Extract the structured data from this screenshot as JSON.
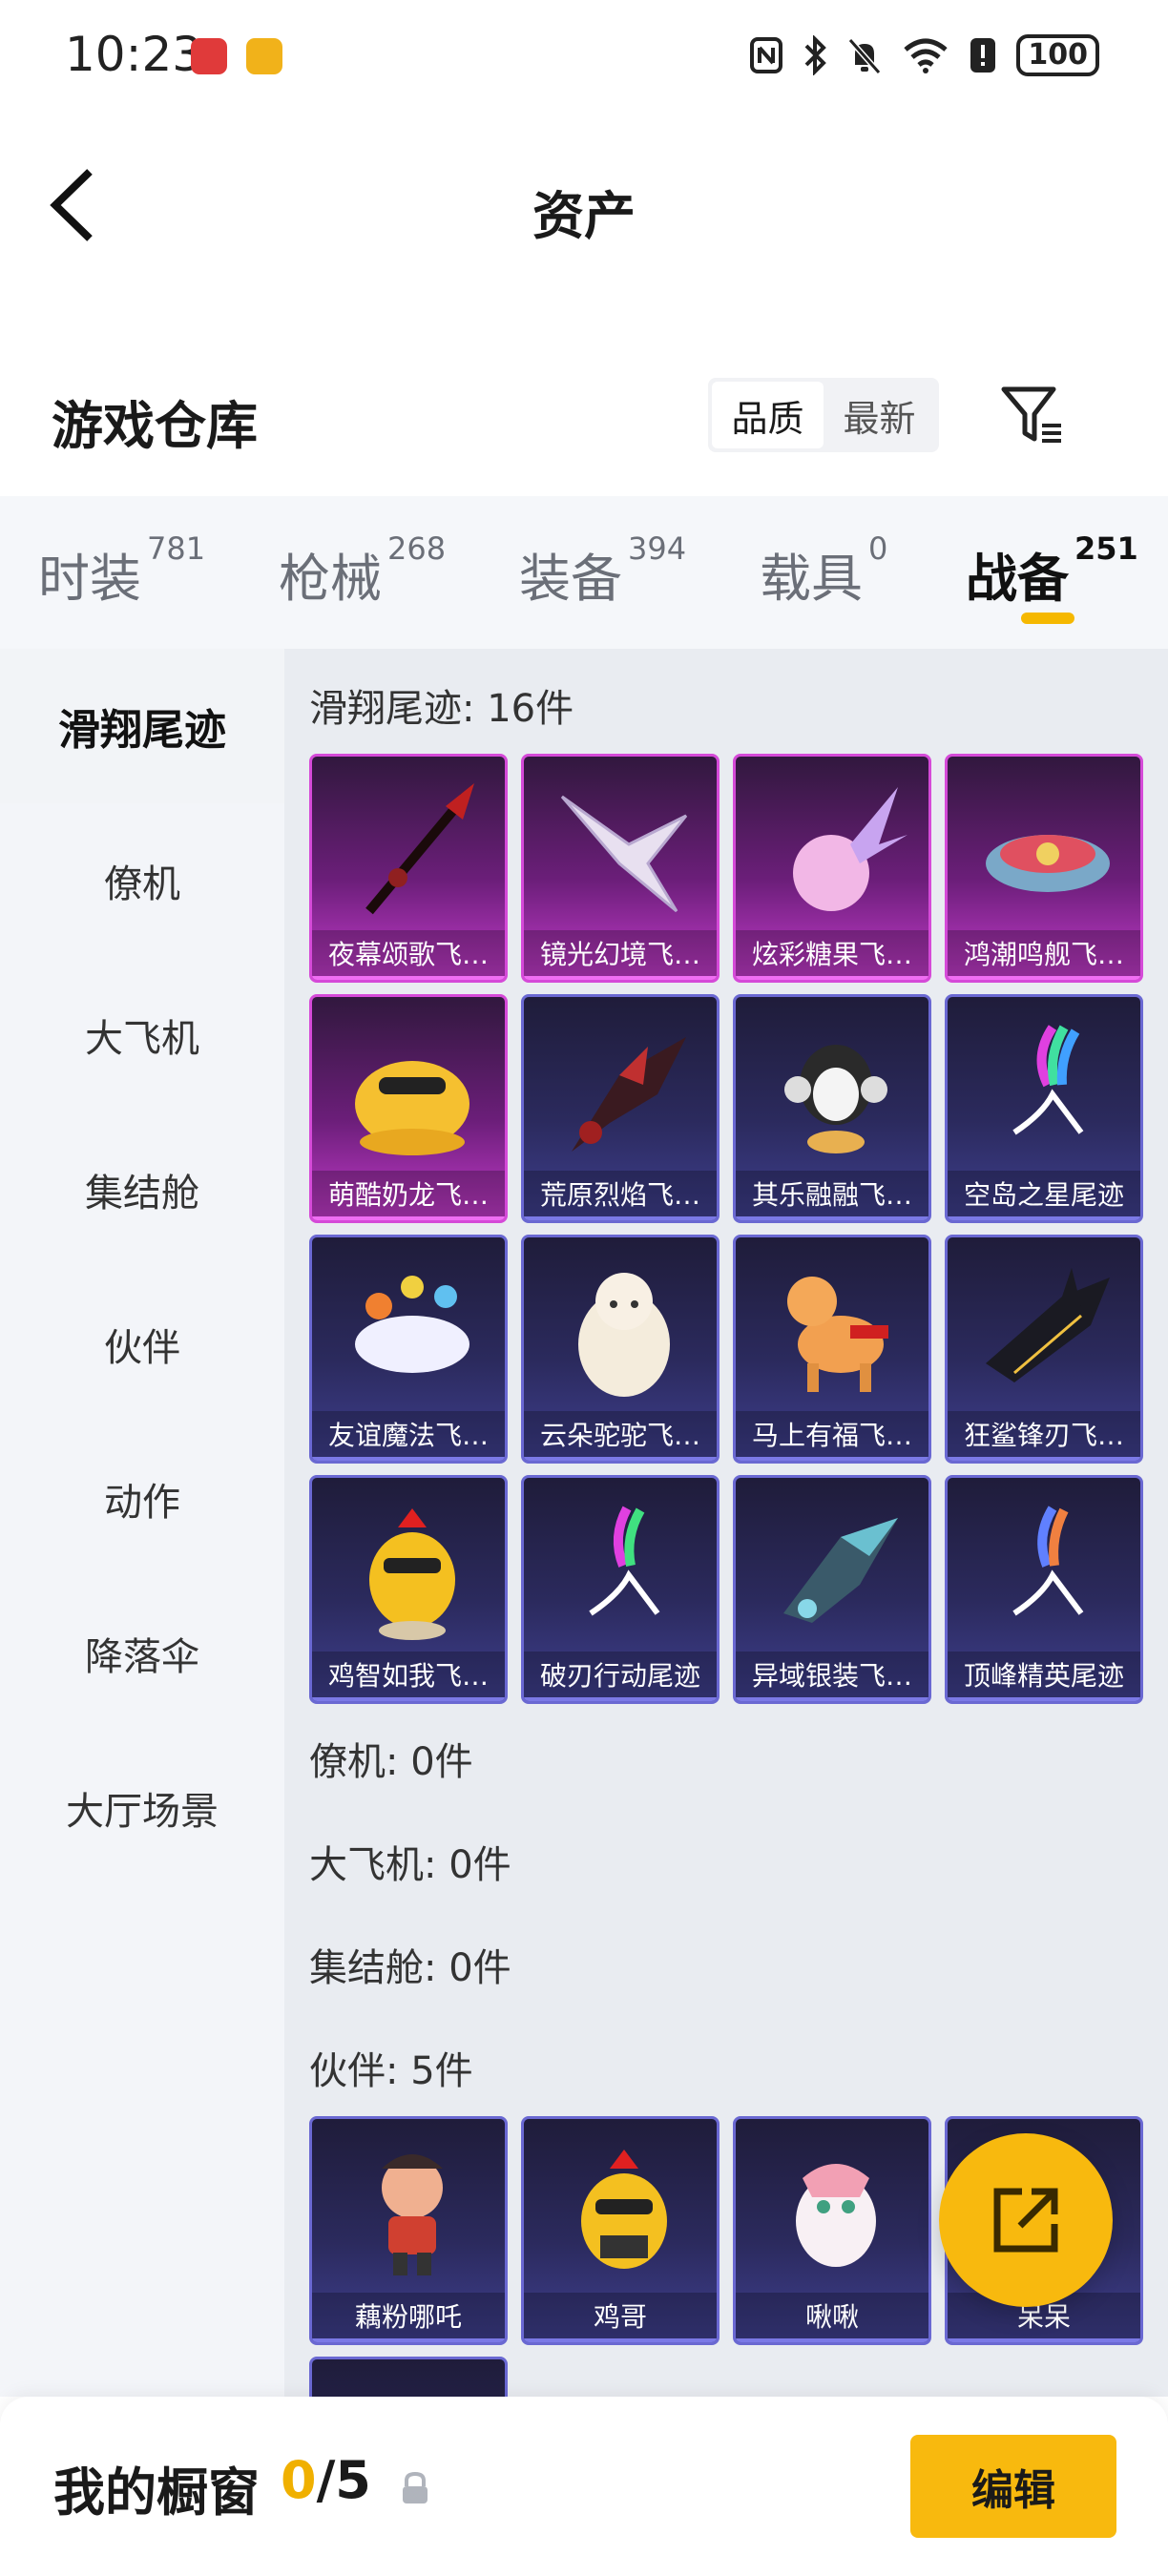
{
  "status_bar": {
    "time": "10:23",
    "battery": "100"
  },
  "header": {
    "title": "资产"
  },
  "warehouse": {
    "title": "游戏仓库",
    "sort_options": [
      "品质",
      "最新"
    ],
    "active_sort": "品质"
  },
  "category_tabs": [
    {
      "label": "时装",
      "count": "781"
    },
    {
      "label": "枪械",
      "count": "268"
    },
    {
      "label": "装备",
      "count": "394"
    },
    {
      "label": "载具",
      "count": "0"
    },
    {
      "label": "战备",
      "count": "251"
    }
  ],
  "active_tab": "战备",
  "sidebar": {
    "items": [
      "滑翔尾迹",
      "僚机",
      "大飞机",
      "集结舱",
      "伙伴",
      "动作",
      "降落伞",
      "大厅场景"
    ],
    "active": "滑翔尾迹"
  },
  "sections": {
    "glide_trail": {
      "title": "滑翔尾迹: 16件",
      "items": [
        "夜幕颂歌飞…",
        "镜光幻境飞…",
        "炫彩糖果飞…",
        "鸿潮鸣舰飞…",
        "萌酷奶龙飞…",
        "荒原烈焰飞…",
        "其乐融融飞…",
        "空岛之星尾迹",
        "友谊魔法飞…",
        "云朵驼驼飞…",
        "马上有福飞…",
        "狂鲨锋刃飞…",
        "鸡智如我飞…",
        "破刃行动尾迹",
        "异域银装飞…",
        "顶峰精英尾迹"
      ]
    },
    "wingman": {
      "title": "僚机: 0件"
    },
    "big_plane": {
      "title": "大飞机: 0件"
    },
    "assembly_pod": {
      "title": "集结舱: 0件"
    },
    "partner": {
      "title": "伙伴: 5件",
      "items": [
        "藕粉哪吒",
        "鸡哥",
        "啾啾",
        "呆呆"
      ]
    }
  },
  "bottom_bar": {
    "showcase_label": "我的橱窗",
    "showcase_current": "0",
    "showcase_total": "/5",
    "edit_label": "编辑"
  },
  "colors": {
    "accent": "#f8b90e",
    "purple_rarity": "#d54ad8",
    "blue_rarity": "#6a68d2"
  }
}
